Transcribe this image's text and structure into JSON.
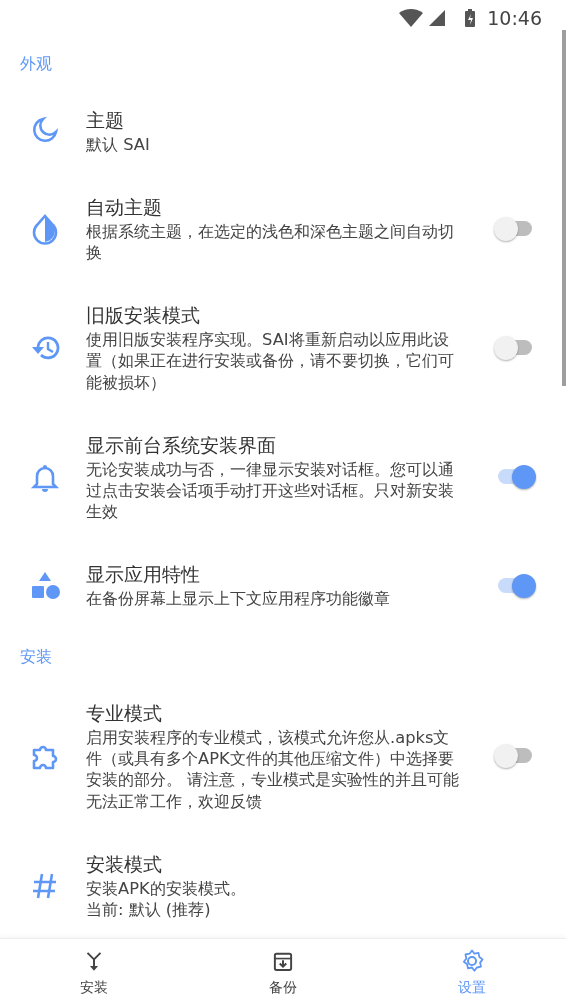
{
  "status_bar": {
    "time": "10:46"
  },
  "sections": [
    {
      "title": "外观",
      "items": [
        {
          "kind": "plain",
          "title": "主题",
          "summary": [
            "默认 SAI"
          ]
        },
        {
          "kind": "switch",
          "title": "自动主题",
          "summary": [
            "根据系统主题，在选定的浅色和深色主题之间自动切换"
          ],
          "on": false
        },
        {
          "kind": "switch",
          "title": "旧版安装模式",
          "summary": [
            "使用旧版安装程序实现。SAI将重新启动以应用此设置（如果正在进行安装或备份，请不要切换，它们可能被损坏）"
          ],
          "on": false
        },
        {
          "kind": "switch",
          "title": "显示前台系统安装界面",
          "summary": [
            "无论安装成功与否，一律显示安装对话框。您可以通过点击安装会话项手动打开这些对话框。只对新安装生效"
          ],
          "on": true
        },
        {
          "kind": "switch",
          "title": "显示应用特性",
          "summary": [
            "在备份屏幕上显示上下文应用程序功能徽章"
          ],
          "on": true
        }
      ]
    },
    {
      "title": "安装",
      "items": [
        {
          "kind": "switch",
          "title": "专业模式",
          "summary": [
            "启用安装程序的专业模式，该模式允许您从.apks文件（或具有多个APK文件的其他压缩文件）中选择要安装的部分。 请注意，专业模式是实验性的并且可能无法正常工作，欢迎反馈"
          ],
          "on": false
        },
        {
          "kind": "plain",
          "title": "安装模式",
          "summary": [
            "安装APK的安装模式。",
            "当前: 默认 (推荐)"
          ]
        }
      ]
    }
  ],
  "bottom_nav": [
    {
      "label": "安装",
      "selected": false
    },
    {
      "label": "备份",
      "selected": false
    },
    {
      "label": "设置",
      "selected": true
    }
  ]
}
